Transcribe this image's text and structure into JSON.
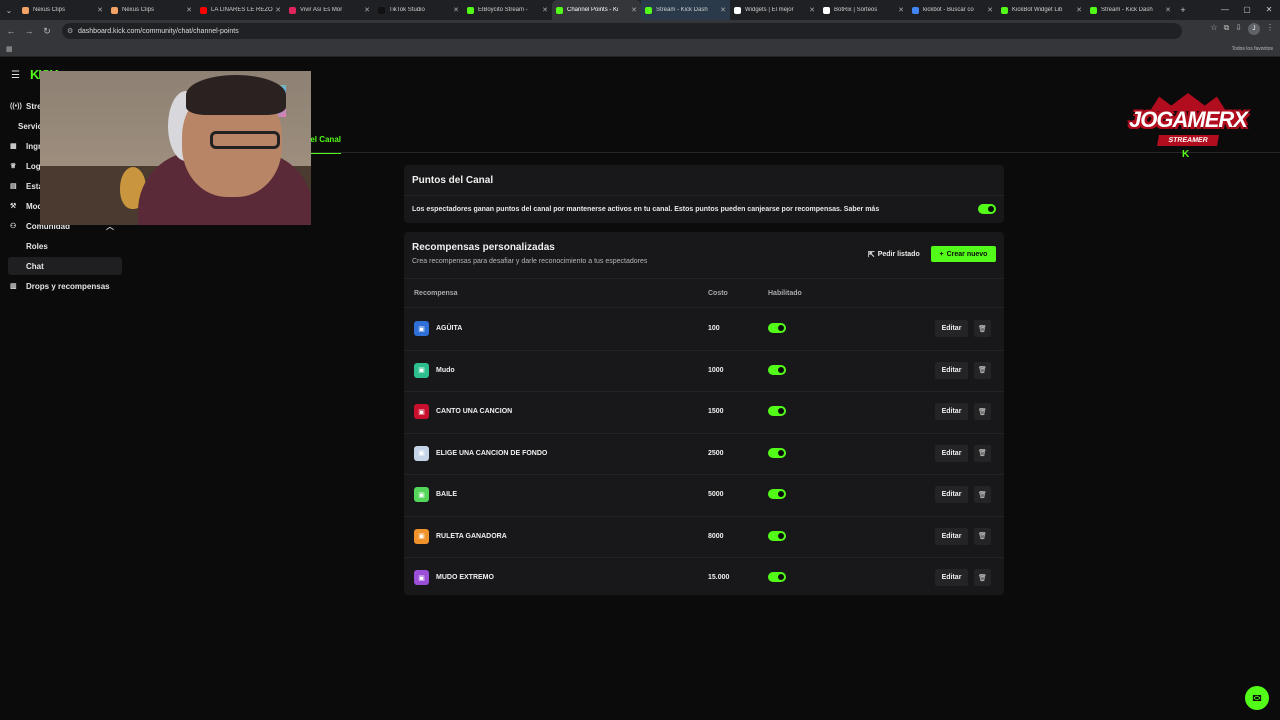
{
  "browser": {
    "tabs": [
      {
        "title": "Nexus Clips",
        "color": "#f2a365",
        "active": false
      },
      {
        "title": "Nexus Clips",
        "color": "#f2a365",
        "active": false
      },
      {
        "title": "LA LINARES LE REZÓ",
        "color": "#ff0000",
        "active": false
      },
      {
        "title": "Vivir Así Es Mor",
        "color": "#e0245e",
        "active": false
      },
      {
        "title": "TikTok Studio",
        "color": "#111111",
        "active": false
      },
      {
        "title": "ElBoycito Stream -",
        "color": "#53fc18",
        "active": false
      },
      {
        "title": "Channel Points - Ki",
        "color": "#53fc18",
        "active": true
      },
      {
        "title": "Stream - Kick Dash",
        "color": "#53fc18",
        "active": false
      },
      {
        "title": "Widgets | El mejor",
        "color": "#ffffff",
        "active": false
      },
      {
        "title": "BotRix | Sorteos",
        "color": "#ffffff",
        "active": false
      },
      {
        "title": "kickbot - Buscar co",
        "color": "#4285f4",
        "active": false
      },
      {
        "title": "KickBot Widget Lib",
        "color": "#53fc18",
        "active": false
      },
      {
        "title": "Stream - Kick Dash",
        "color": "#53fc18",
        "active": false
      }
    ],
    "url": "dashboard.kick.com/community/chat/channel-points",
    "favorites_label": "Todos los favoritos",
    "profile_initial": "J"
  },
  "app": {
    "logo": "KICK",
    "sidebar": {
      "items": [
        {
          "label": "Stream",
          "icon": "broadcast-icon",
          "glyph": "((•))"
        },
        {
          "label": "Servicios",
          "icon": "",
          "glyph": ""
        },
        {
          "label": "Ingresos",
          "icon": "revenue-icon",
          "glyph": "▦"
        },
        {
          "label": "Logros",
          "icon": "trophy-icon",
          "glyph": "♕"
        },
        {
          "label": "Estadísticas",
          "icon": "stats-icon",
          "glyph": "▤"
        },
        {
          "label": "Moderación",
          "icon": "wrench-icon",
          "glyph": "⚒"
        },
        {
          "label": "Comunidad",
          "icon": "community-icon",
          "glyph": "⚇"
        }
      ],
      "sub_items": [
        {
          "label": "Roles"
        },
        {
          "label": "Chat"
        }
      ],
      "drops": {
        "label": "Drops y recompensas",
        "glyph": "▥"
      }
    },
    "page_tab": "Puntos del Canal",
    "channel_points": {
      "title": "Puntos del Canal",
      "description": "Los espectadores ganan puntos del canal por mantenerse activos en tu canal. Estos puntos pueden canjearse por recompensas. Saber más",
      "enabled": true
    },
    "rewards": {
      "title": "Recompensas personalizadas",
      "subtitle": "Crea recompensas para desafiar y darle reconocimiento a tus espectadores",
      "request_list_label": "Pedir listado",
      "create_new_label": "Crear nuevo",
      "columns": [
        "Recompensa",
        "Costo",
        "Habilitado"
      ],
      "edit_label": "Editar",
      "items": [
        {
          "name": "AGÜITA",
          "cost": "100",
          "color": "#2f6fd8",
          "enabled": true
        },
        {
          "name": "Mudo",
          "cost": "1000",
          "color": "#2fbf8f",
          "enabled": true
        },
        {
          "name": "CANTO UNA CANCION",
          "cost": "1500",
          "color": "#c8102e",
          "enabled": true
        },
        {
          "name": "ELIGE UNA CANCION DE FONDO",
          "cost": "2500",
          "color": "#c6d4e8",
          "enabled": true
        },
        {
          "name": "BAILE",
          "cost": "5000",
          "color": "#53d65a",
          "enabled": true
        },
        {
          "name": "RULETA GANADORA",
          "cost": "8000",
          "color": "#f0922b",
          "enabled": true
        },
        {
          "name": "MUDO EXTREMO",
          "cost": "15.000",
          "color": "#9b4fd8",
          "enabled": true
        }
      ]
    }
  },
  "overlay": {
    "brand": "JOGAMERX",
    "tagline": "STREAMER",
    "mark": "K"
  }
}
